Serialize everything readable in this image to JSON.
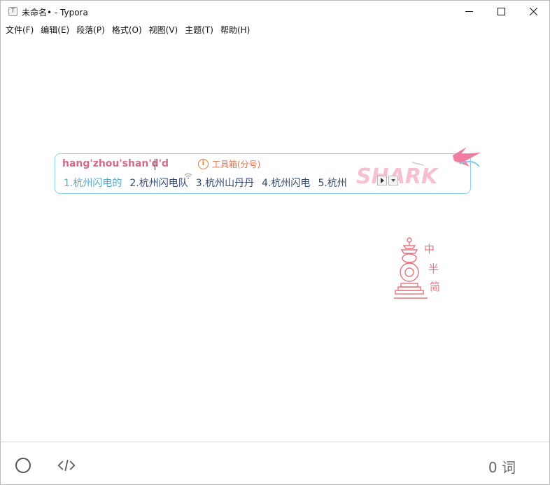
{
  "titlebar": {
    "app_icon_letter": "T",
    "title": "未命名• - Typora",
    "icons": {
      "minimize": "minimize-icon",
      "maximize": "maximize-icon",
      "close": "close-icon"
    }
  },
  "menu": [
    "文件(F)",
    "编辑(E)",
    "段落(P)",
    "格式(O)",
    "视图(V)",
    "主题(T)",
    "帮助(H)"
  ],
  "ime": {
    "input": "hang'zhou'shan'd'd",
    "toolbox_label": "工具箱(分号)",
    "candidates": [
      "1.杭州闪电的",
      "2.杭州闪电队",
      "3.杭州山丹丹",
      "4.杭州闪电",
      "5.杭州"
    ],
    "active_index": 0,
    "skin_logo_text": "SHARK",
    "colors": {
      "border": "#8fd0ee",
      "input": "#d46a8a",
      "active": "#5aa9c6",
      "candidate": "#31496f",
      "accent": "#e67a33"
    }
  },
  "seal": {
    "chars": [
      "中",
      "半",
      "简"
    ],
    "color": "#e5737c"
  },
  "footer": {
    "word_count": "0 词",
    "icons": {
      "sidebar": "circle-outline-icon",
      "source": "code-brackets-icon"
    }
  }
}
